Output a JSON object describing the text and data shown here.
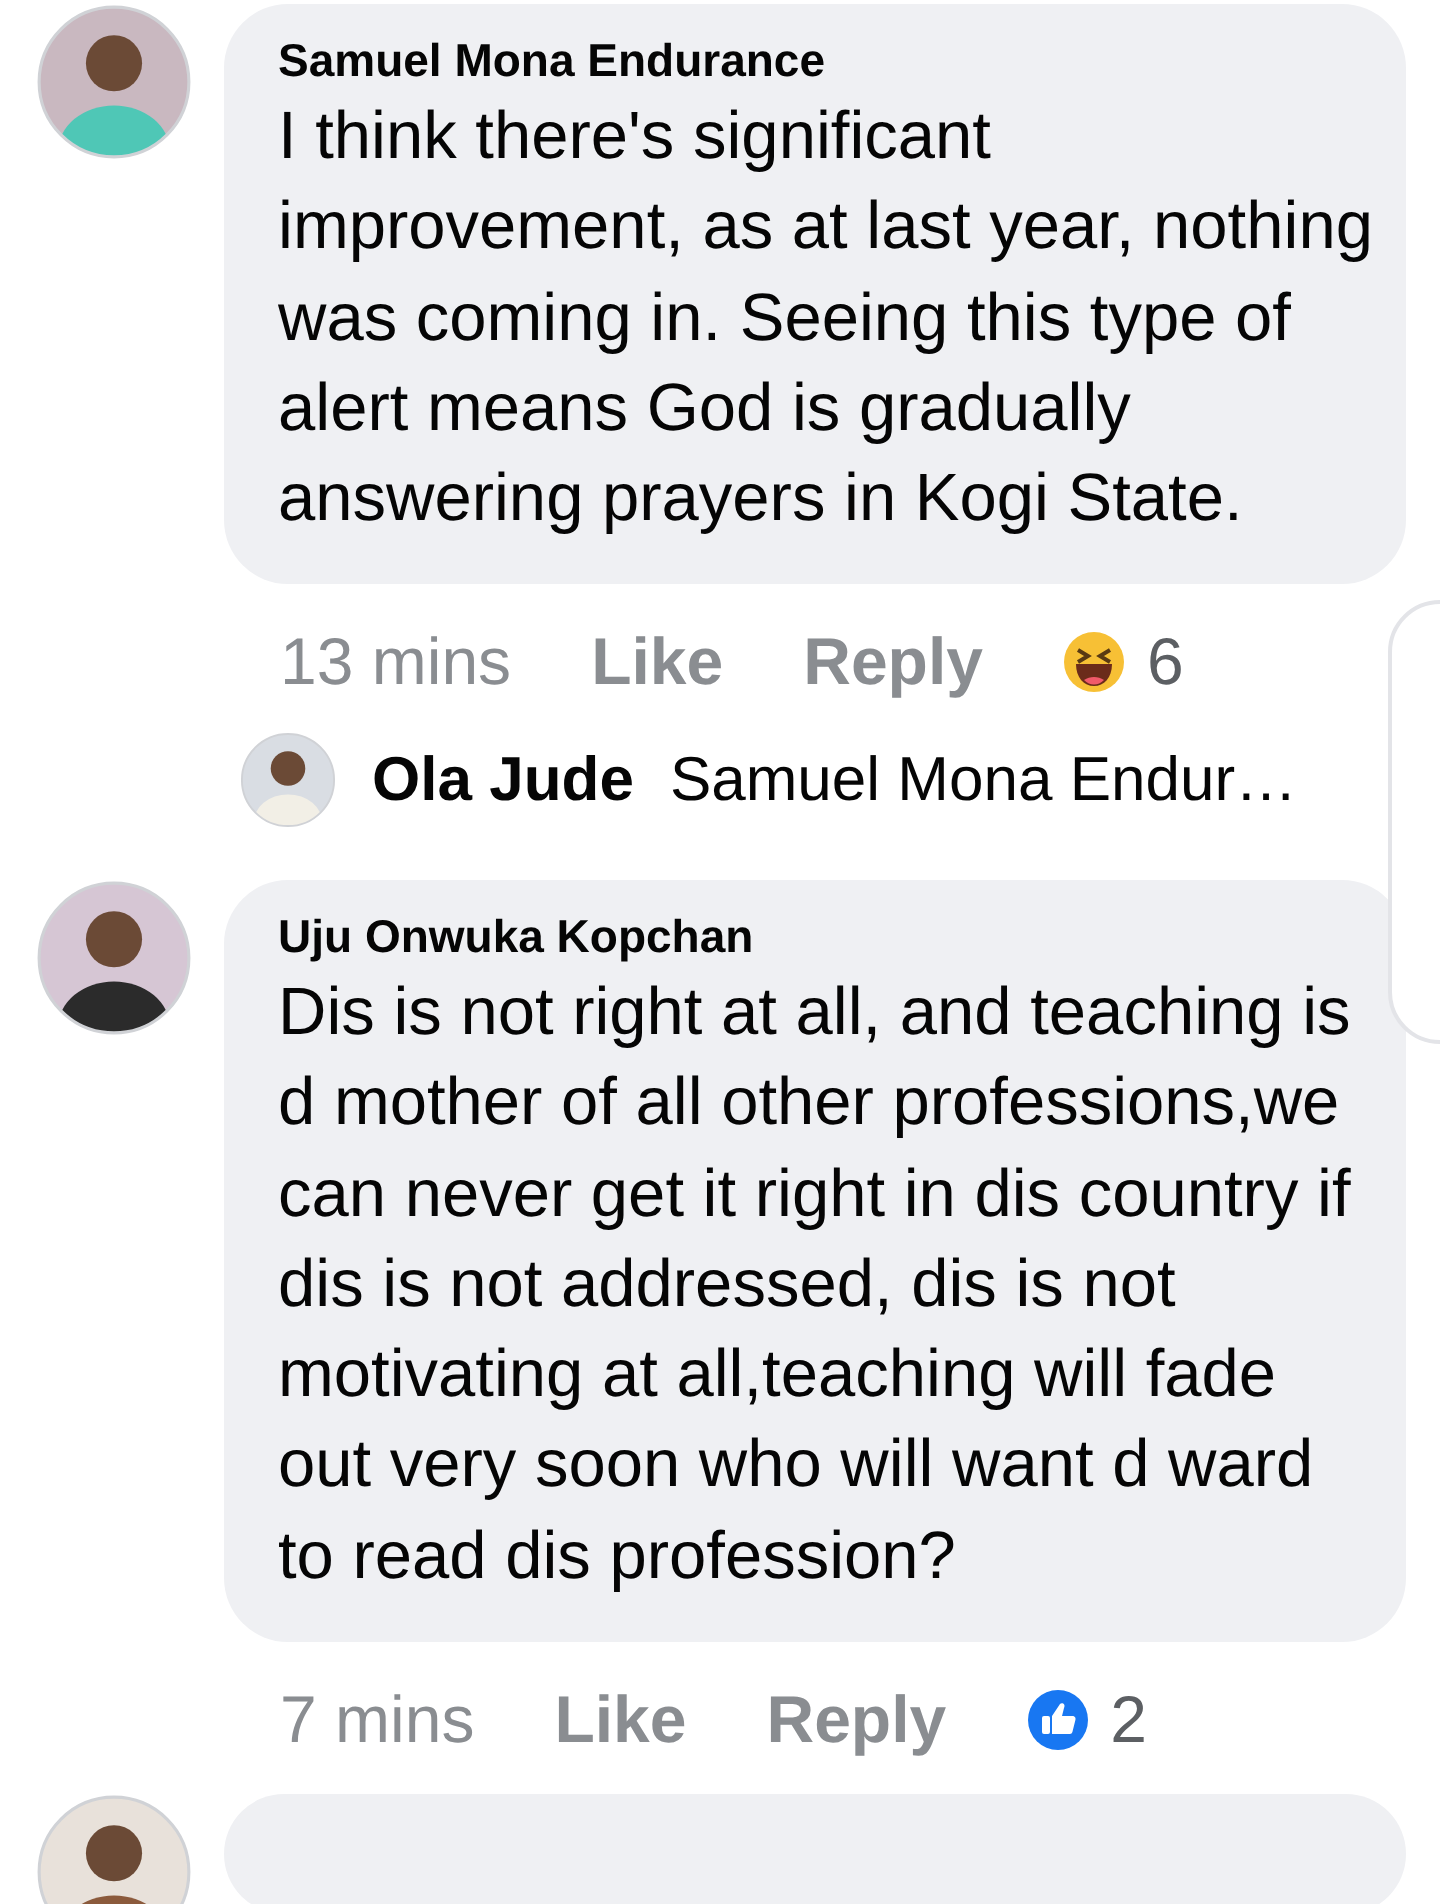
{
  "comments": [
    {
      "author": "Samuel Mona Endurance",
      "text": "I think there's significant improvement, as at last year, nothing was coming in. Seeing this type of alert means God is gradually answering prayers in Kogi State.",
      "time": "13 mins",
      "like": "Like",
      "reply": "Reply",
      "reaction": {
        "kind": "haha",
        "count": "6"
      },
      "replies": [
        {
          "author": "Ola Jude",
          "text": "Samuel Mona Endur…"
        }
      ]
    },
    {
      "author": "Uju Onwuka Kopchan",
      "text": "Dis is not right  at all, and teaching is d mother of all other professions,we can never  get it right in dis country if dis is not addressed, dis is not motivating at all,teaching will fade out very soon who will want  d ward to read dis profession?",
      "time": "7 mins",
      "like": "Like",
      "reply": "Reply",
      "reaction": {
        "kind": "like",
        "count": "2"
      }
    }
  ]
}
